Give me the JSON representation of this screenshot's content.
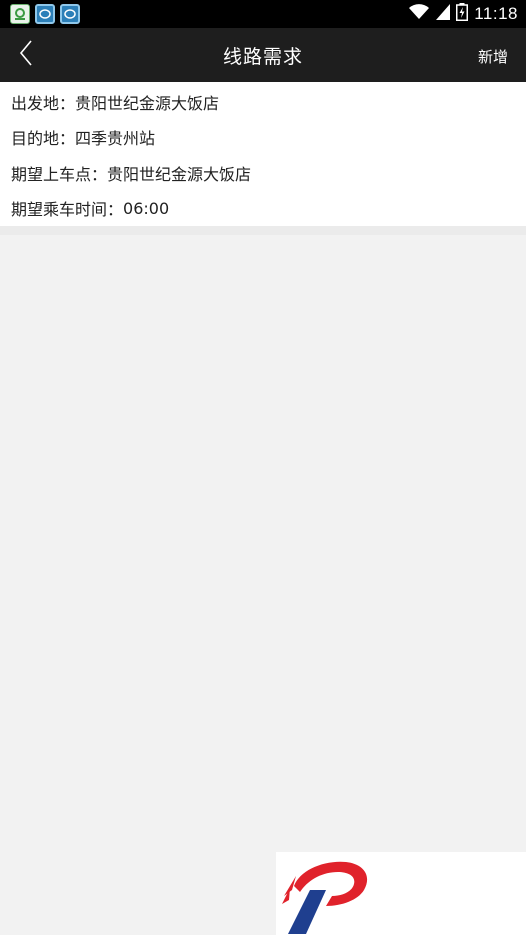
{
  "status_bar": {
    "app_icons": [
      "green-app-icon",
      "blue-app-icon",
      "blue-app-icon"
    ],
    "time": "11:18",
    "icons": [
      "wifi-icon",
      "signal-icon",
      "battery-icon"
    ]
  },
  "header": {
    "title": "线路需求",
    "back_icon": "chevron-left-icon",
    "add_label": "新增",
    "background": "#1e1e1e"
  },
  "info": {
    "departure_label": "出发地：",
    "departure_value": "贵阳世纪金源大饭店",
    "destination_label": "目的地：",
    "destination_value": "四季贵州站",
    "pickup_label": "期望上车点：",
    "pickup_value": "贵阳世纪金源大饭店",
    "time_label": "期望乘车时间：",
    "time_value": "06:00"
  },
  "logo": {
    "icon": "brand-logo-icon",
    "colors": {
      "red": "#e0222b",
      "blue": "#1f3f8f"
    }
  }
}
